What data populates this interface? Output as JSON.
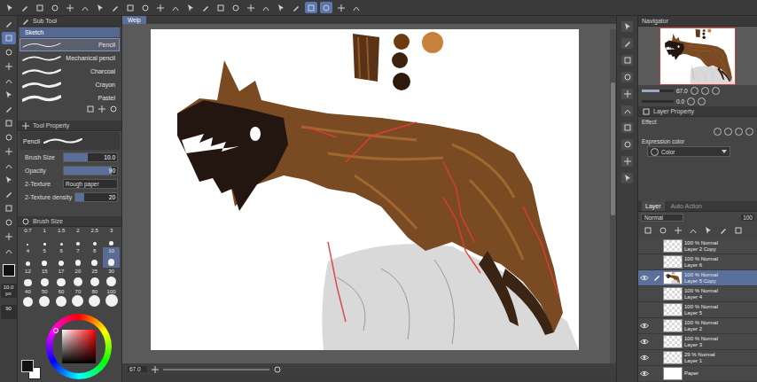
{
  "toolbar": {
    "buttons": [
      {
        "selected": false
      },
      {
        "selected": false
      },
      {
        "selected": false
      },
      {
        "selected": false
      },
      {
        "selected": false
      },
      {
        "selected": false
      },
      {
        "selected": false
      },
      {
        "selected": false
      },
      {
        "selected": false
      },
      {
        "selected": false
      },
      {
        "selected": false
      },
      {
        "selected": false
      },
      {
        "selected": false
      },
      {
        "selected": false
      },
      {
        "selected": false
      },
      {
        "selected": false
      },
      {
        "selected": false
      },
      {
        "selected": false
      },
      {
        "selected": false
      },
      {
        "selected": false
      },
      {
        "selected": true
      },
      {
        "selected": true
      },
      {
        "selected": false
      },
      {
        "selected": false
      }
    ]
  },
  "tools": [
    {
      "selected": false
    },
    {
      "selected": true
    },
    {
      "selected": false
    },
    {
      "selected": false
    },
    {
      "selected": false
    },
    {
      "selected": false
    },
    {
      "selected": false
    },
    {
      "selected": false
    },
    {
      "selected": false
    },
    {
      "selected": false
    },
    {
      "selected": false
    },
    {
      "selected": false
    },
    {
      "selected": false
    },
    {
      "selected": false
    },
    {
      "selected": false
    },
    {
      "selected": false
    },
    {
      "selected": false
    }
  ],
  "brush_readout": {
    "size": "10.0 px",
    "opacity": "90"
  },
  "sub_tool": {
    "title": "Sub Tool",
    "group": "Sketch",
    "brushes": [
      {
        "name": "Pencil",
        "selected": true
      },
      {
        "name": "Mechanical pencil",
        "selected": false
      },
      {
        "name": "Charcoal",
        "selected": false
      },
      {
        "name": "Crayon",
        "selected": false
      },
      {
        "name": "Pastel",
        "selected": false
      }
    ]
  },
  "tool_property": {
    "title": "Tool Property",
    "preview": "Pencil",
    "rows": [
      {
        "kind": "slider",
        "label": "Brush Size",
        "value": "10.0",
        "level": 0.45
      },
      {
        "kind": "slider",
        "label": "Opacity",
        "value": "90",
        "level": 0.9
      },
      {
        "kind": "select",
        "label": "2-Texture",
        "value": "Rough paper"
      },
      {
        "kind": "slider",
        "label": "2-Texture density",
        "value": "20",
        "level": 0.2
      }
    ]
  },
  "brush_size": {
    "title": "Brush Size",
    "sizes": [
      {
        "label": "0.7",
        "selected": false
      },
      {
        "label": "1",
        "selected": false
      },
      {
        "label": "1.5",
        "selected": false
      },
      {
        "label": "2",
        "selected": false
      },
      {
        "label": "2.5",
        "selected": false
      },
      {
        "label": "3",
        "selected": false
      },
      {
        "label": "4",
        "selected": false
      },
      {
        "label": "5",
        "selected": false
      },
      {
        "label": "6",
        "selected": false
      },
      {
        "label": "7",
        "selected": false
      },
      {
        "label": "8",
        "selected": false
      },
      {
        "label": "10",
        "selected": true
      },
      {
        "label": "12",
        "selected": false
      },
      {
        "label": "15",
        "selected": false
      },
      {
        "label": "17",
        "selected": false
      },
      {
        "label": "20",
        "selected": false
      },
      {
        "label": "25",
        "selected": false
      },
      {
        "label": "30",
        "selected": false
      },
      {
        "label": "40",
        "selected": false
      },
      {
        "label": "50",
        "selected": false
      },
      {
        "label": "60",
        "selected": false
      },
      {
        "label": "70",
        "selected": false
      },
      {
        "label": "80",
        "selected": false
      },
      {
        "label": "100",
        "selected": false
      }
    ]
  },
  "canvas": {
    "tab": "Welp",
    "swatches": [
      {
        "kind": "streak",
        "color": "#5a3216"
      },
      {
        "kind": "dot",
        "color": "#6e3a12"
      },
      {
        "kind": "dot",
        "color": "#3e2410"
      },
      {
        "kind": "dot",
        "color": "#2e1a0c"
      },
      {
        "kind": "dot",
        "color": "#c8803c"
      }
    ]
  },
  "status_bar": {
    "zoom": "67.0"
  },
  "navigator": {
    "title": "Navigator",
    "zoom": "67.0",
    "zoom_level": 0.55,
    "angle": "0.0"
  },
  "layer_property": {
    "title": "Layer Property",
    "effect": "Effect",
    "expression_label": "Expression color",
    "expression_value": "Color"
  },
  "layers": {
    "tabs": [
      {
        "label": "Layer",
        "selected": true
      },
      {
        "label": "Auto Action",
        "selected": false
      }
    ],
    "blend_mode": "Normal",
    "opacity": "100",
    "items": [
      {
        "blend": "100 % Normal",
        "name": "Layer 2 Copy",
        "visible": false,
        "selected": false,
        "kind": "raster"
      },
      {
        "blend": "100 % Normal",
        "name": "Layer 6",
        "visible": false,
        "selected": false,
        "kind": "raster"
      },
      {
        "blend": "100 % Normal",
        "name": "Layer 5 Copy",
        "visible": true,
        "selected": true,
        "kind": "art"
      },
      {
        "blend": "100 % Normal",
        "name": "Layer 4",
        "visible": false,
        "selected": false,
        "kind": "raster"
      },
      {
        "blend": "100 % Normal",
        "name": "Layer 5",
        "visible": false,
        "selected": false,
        "kind": "raster"
      },
      {
        "blend": "100 % Normal",
        "name": "Layer 2",
        "visible": true,
        "selected": false,
        "kind": "raster"
      },
      {
        "blend": "100 % Normal",
        "name": "Layer 3",
        "visible": true,
        "selected": false,
        "kind": "raster"
      },
      {
        "blend": "29 % Normal",
        "name": "Layer 1",
        "visible": true,
        "selected": false,
        "kind": "raster"
      },
      {
        "name": "Paper",
        "visible": true,
        "selected": false,
        "kind": "paper"
      }
    ]
  }
}
